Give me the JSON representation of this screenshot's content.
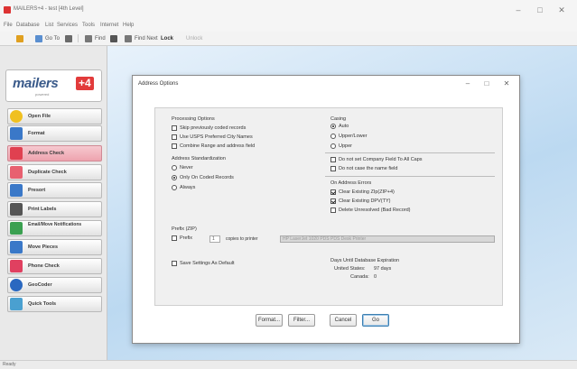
{
  "window": {
    "title": "MAILERS+4 - test [4th Level]",
    "controls": {
      "minimize": "–",
      "maximize": "□",
      "close": "✕"
    }
  },
  "menu": [
    "File",
    "Database",
    "List",
    "Services",
    "Tools",
    "Internet",
    "Help"
  ],
  "toolbar": {
    "items": [
      {
        "label": "",
        "icon": "folder-icon",
        "color": "#e0a020"
      },
      {
        "label": "Go To",
        "icon": "goto-icon",
        "color": "#5a8fd0"
      },
      {
        "label": "",
        "icon": "grid-icon",
        "color": "#6a6a6a"
      },
      {
        "label": "Find",
        "icon": "find-icon",
        "color": "#777"
      },
      {
        "label": "",
        "icon": "binoculars-icon",
        "color": "#555"
      },
      {
        "label": "Find Next",
        "icon": "find-next-icon",
        "color": "#777"
      },
      {
        "label": "Lock",
        "icon": "lock-icon",
        "color": "#333"
      },
      {
        "label": "Unlock",
        "icon": "unlock-icon",
        "color": "#aaa"
      }
    ]
  },
  "logo": {
    "main": "mailers",
    "badge": "+4",
    "sub": "powered"
  },
  "sidebar": {
    "items": [
      {
        "label": "Open File",
        "icon": "open-file-icon",
        "color": "#f0c020",
        "active": false
      },
      {
        "label": "Format",
        "icon": "format-icon",
        "color": "#3a78c8",
        "active": false
      },
      {
        "label": "Address Check",
        "icon": "address-check-icon",
        "color": "#e04050",
        "active": true
      },
      {
        "label": "Duplicate Check",
        "icon": "duplicate-check-icon",
        "color": "#e86070",
        "active": false
      },
      {
        "label": "Presort",
        "icon": "presort-icon",
        "color": "#3a78c8",
        "active": false
      },
      {
        "label": "Print Labels",
        "icon": "print-labels-icon",
        "color": "#555",
        "active": false
      },
      {
        "label": "Email/Move Notifications",
        "icon": "email-move-icon",
        "color": "#3aa050",
        "active": false
      },
      {
        "label": "Move Pieces",
        "icon": "move-pieces-icon",
        "color": "#3a78c8",
        "active": false
      },
      {
        "label": "Phone Check",
        "icon": "phone-check-icon",
        "color": "#e04060",
        "active": false
      },
      {
        "label": "GeoCoder",
        "icon": "geocoder-icon",
        "color": "#2a68c0",
        "active": false
      },
      {
        "label": "Quick Tools",
        "icon": "quick-tools-icon",
        "color": "#4aa0d0",
        "active": false
      }
    ]
  },
  "dialog": {
    "title": "Address Options",
    "processing_options": {
      "label": "Processing Options",
      "items": [
        {
          "label": "Skip previously coded records",
          "checked": false
        },
        {
          "label": "Use USPS Preferred City Names",
          "checked": false
        },
        {
          "label": "Combine Range and address field",
          "checked": false
        }
      ]
    },
    "address_standardization": {
      "label": "Address Standardization",
      "items": [
        {
          "label": "Never",
          "checked": false
        },
        {
          "label": "Only On Coded Records",
          "checked": true
        },
        {
          "label": "Always",
          "checked": false
        }
      ]
    },
    "casing": {
      "label": "Casing",
      "items": [
        {
          "label": "Auto",
          "checked": true
        },
        {
          "label": "Upper/Lower",
          "checked": false
        },
        {
          "label": "Upper",
          "checked": false
        }
      ]
    },
    "company_options": [
      {
        "label": "Do not set Company Field To All Caps",
        "checked": false
      },
      {
        "label": "Do not case the name field",
        "checked": false
      }
    ],
    "on_address_errors": {
      "label": "On Address Errors",
      "items": [
        {
          "label": "Clear Existing ZIp(ZIP+4)",
          "checked": true
        },
        {
          "label": "Clear Existing DPV(TY)",
          "checked": true
        },
        {
          "label": "Delete Unresolved (Bad Record)",
          "checked": false
        }
      ]
    },
    "prefix": {
      "label": "Prefix (ZIP)",
      "checkbox_label": "Prefix",
      "value": "1",
      "caption": "copies to printer",
      "printer": "HP LaserJet 1020 PDS PDS Desk Printer"
    },
    "save_default": {
      "label": "Save Settings As Default",
      "checked": false
    },
    "expiration": {
      "title": "Days Until Database Expiration",
      "us_label": "United States:",
      "us_value": "97 days",
      "ca_label": "Canada:",
      "ca_value": "0"
    },
    "buttons": {
      "format": "Format...",
      "filter": "Filter...",
      "cancel": "Cancel",
      "ok": "Go"
    }
  },
  "status": {
    "text": "Ready"
  }
}
